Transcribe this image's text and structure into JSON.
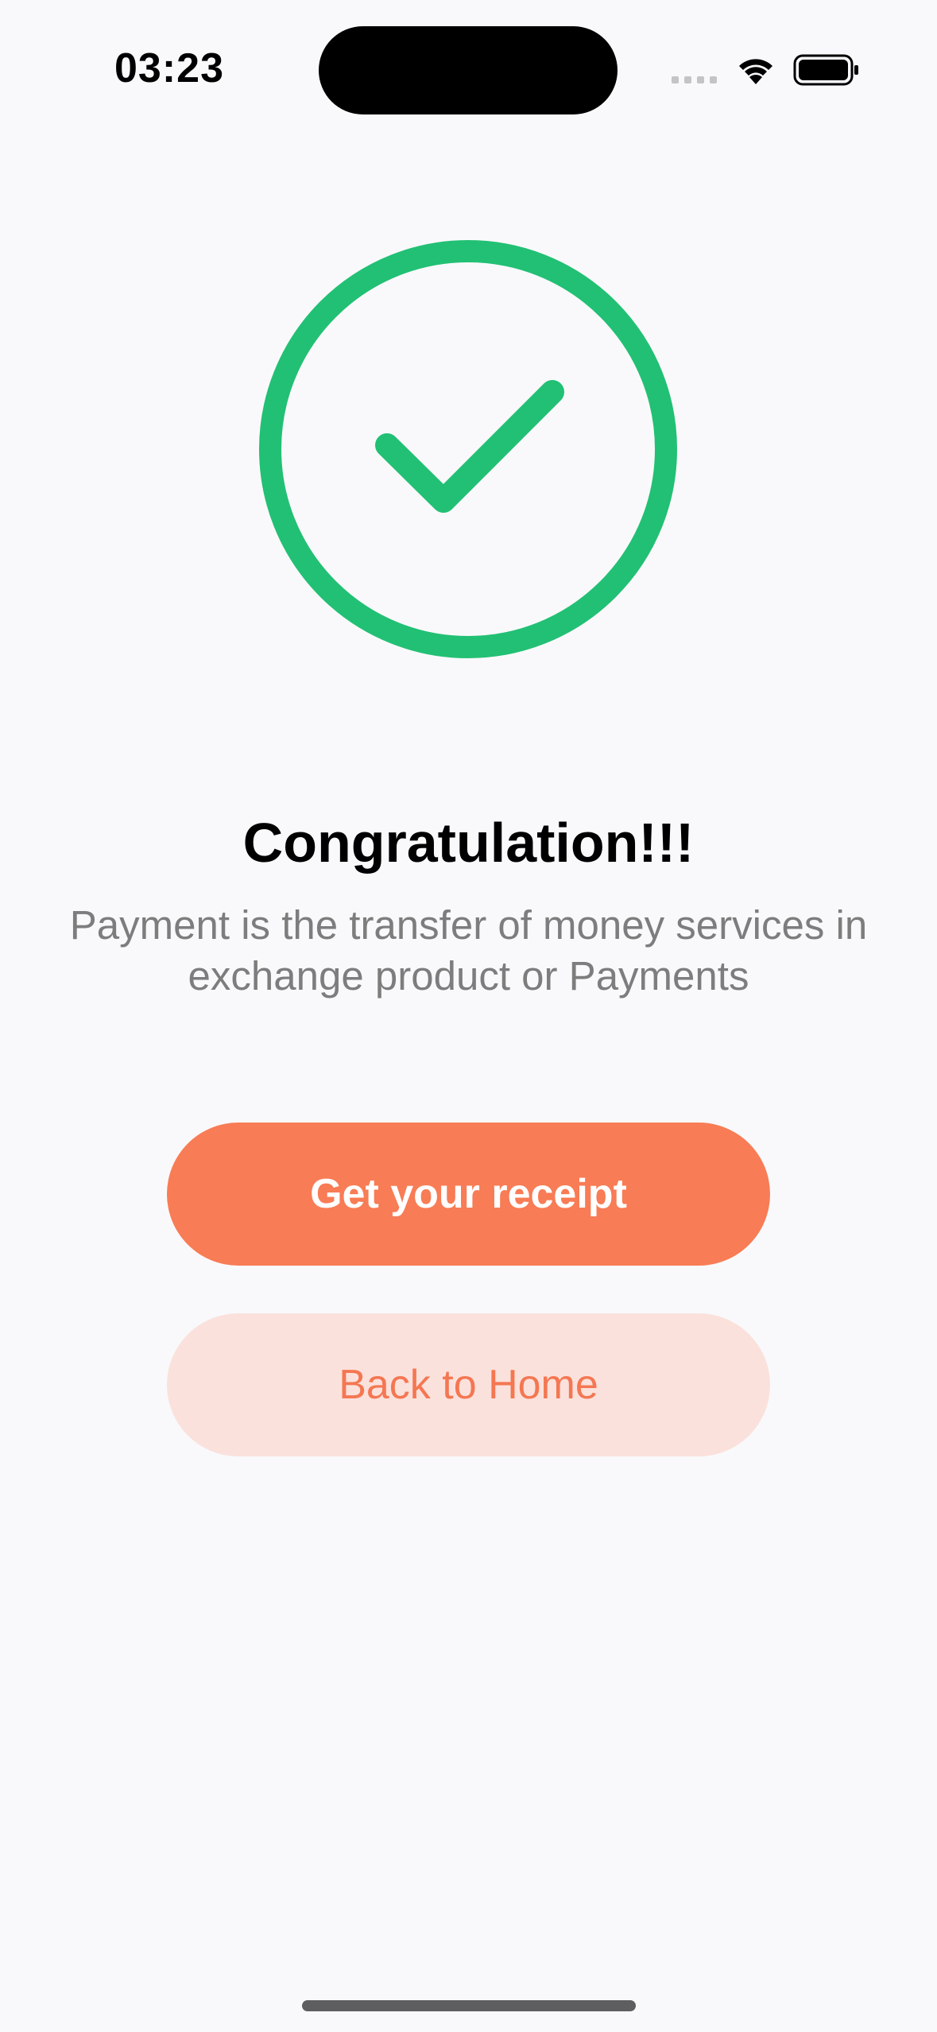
{
  "status_bar": {
    "time": "03:23",
    "icons": [
      "cellular-signal-icon",
      "wifi-icon",
      "battery-icon"
    ]
  },
  "success": {
    "icon": "check-circle-icon",
    "title": "Congratulation!!!",
    "message": "Payment is the transfer of money services in exchange product or Payments"
  },
  "actions": {
    "receipt_label": "Get your receipt",
    "home_label": "Back to Home"
  },
  "colors": {
    "success_green": "#22c074",
    "accent_orange": "#f87c55",
    "accent_light": "#fbe1dc",
    "background": "#f9f9fb",
    "muted_text": "#7d7d7d"
  }
}
